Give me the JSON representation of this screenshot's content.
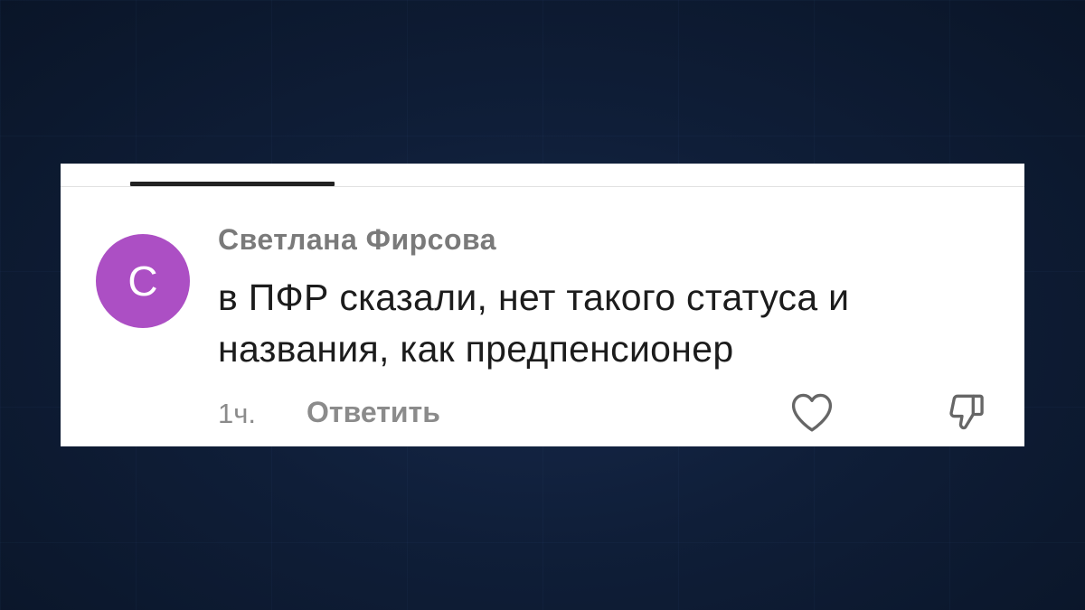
{
  "comment": {
    "avatar_letter": "С",
    "author": "Светлана Фирсова",
    "text": "в ПФР сказали, нет такого статуса и названия, как предпенсионер",
    "timestamp": "1ч.",
    "reply_label": "Ответить",
    "like_icon": "heart-outline-icon",
    "dislike_icon": "thumbs-down-outline-icon"
  },
  "colors": {
    "avatar_bg": "#ac4fc4",
    "icon_stroke": "#666666"
  }
}
